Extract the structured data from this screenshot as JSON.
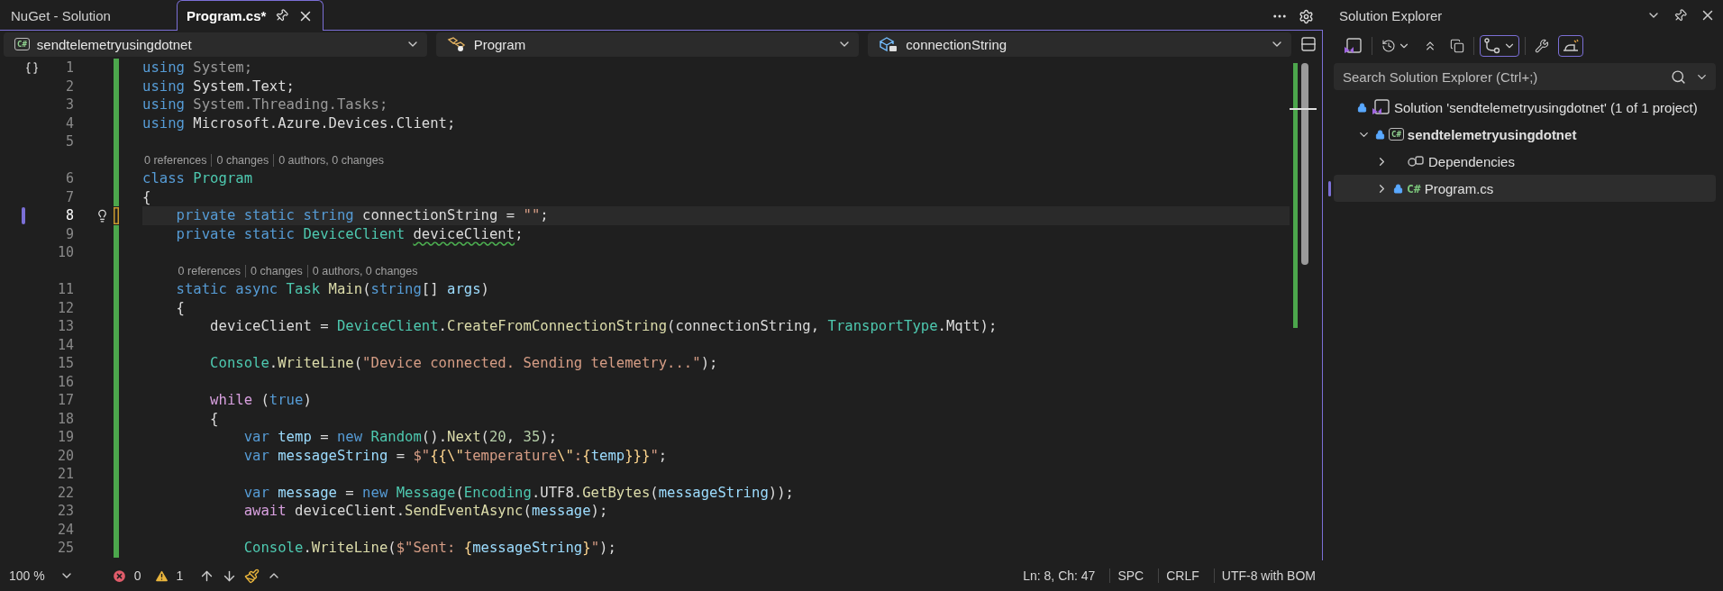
{
  "tabs": [
    {
      "label": "NuGet - Solution",
      "selected": false,
      "pinned": false
    },
    {
      "label": "Program.cs*",
      "selected": true,
      "pinned": true
    }
  ],
  "nav_bar": {
    "project": {
      "icon_text": "C#",
      "label": "sendtelemetryusingdotnet"
    },
    "type": {
      "label": "Program"
    },
    "member": {
      "label": "connectionString"
    }
  },
  "editor": {
    "lines": [
      {
        "number": "1",
        "current": false,
        "unsaved": false,
        "tokens": [
          {
            "kind": "kw",
            "text": "using"
          },
          {
            "kind": "dim",
            "text": " System;"
          }
        ]
      },
      {
        "number": "2",
        "current": false,
        "unsaved": false,
        "tokens": [
          {
            "kind": "kw",
            "text": "using"
          },
          {
            "kind": "plain",
            "text": " System.Text;"
          }
        ]
      },
      {
        "number": "3",
        "current": false,
        "unsaved": false,
        "tokens": [
          {
            "kind": "kw",
            "text": "using"
          },
          {
            "kind": "dim",
            "text": " System.Threading.Tasks;"
          }
        ]
      },
      {
        "number": "4",
        "current": false,
        "unsaved": false,
        "tokens": [
          {
            "kind": "kw",
            "text": "using"
          },
          {
            "kind": "plain",
            "text": " Microsoft.Azure.Devices.Client;"
          }
        ]
      },
      {
        "number": "5",
        "current": false,
        "unsaved": false
      },
      {
        "number": "6",
        "current": false,
        "unsaved": false,
        "lens": [
          "0 references",
          "0 changes",
          "0 authors, 0 changes"
        ],
        "tokens": [
          {
            "kind": "kw",
            "text": "class "
          },
          {
            "kind": "type",
            "text": "Program"
          }
        ]
      },
      {
        "number": "7",
        "current": false,
        "unsaved": false,
        "tokens": [
          {
            "kind": "plain",
            "text": "{"
          }
        ]
      },
      {
        "number": "8",
        "current": true,
        "unsaved": true,
        "tokens": [
          {
            "kind": "kw",
            "text": "    private static string "
          },
          {
            "kind": "plain",
            "text": "connectionString = "
          },
          {
            "kind": "str",
            "text": "\"\""
          },
          {
            "kind": "plain",
            "text": ";"
          }
        ]
      },
      {
        "number": "9",
        "current": false,
        "unsaved": false,
        "tokens": [
          {
            "kind": "kw",
            "text": "    private static "
          },
          {
            "kind": "type",
            "text": "DeviceClient "
          },
          {
            "kind": "warn",
            "text": "deviceClient"
          },
          {
            "kind": "plain",
            "text": ";"
          }
        ]
      },
      {
        "number": "10",
        "current": false,
        "unsaved": false
      },
      {
        "number": "11",
        "current": false,
        "unsaved": false,
        "lens": [
          "0 references",
          "0 changes",
          "0 authors, 0 changes"
        ],
        "tokens": [
          {
            "kind": "kw",
            "text": "    static async "
          },
          {
            "kind": "type",
            "text": "Task "
          },
          {
            "kind": "method",
            "text": "Main"
          },
          {
            "kind": "plain",
            "text": "("
          },
          {
            "kind": "kw",
            "text": "string"
          },
          {
            "kind": "plain",
            "text": "[] "
          },
          {
            "kind": "ident",
            "text": "args"
          },
          {
            "kind": "plain",
            "text": ")"
          }
        ]
      },
      {
        "number": "12",
        "current": false,
        "unsaved": false,
        "tokens": [
          {
            "kind": "plain",
            "text": "    {"
          }
        ]
      },
      {
        "number": "13",
        "current": false,
        "unsaved": false,
        "tokens": [
          {
            "kind": "plain",
            "text": "        deviceClient = "
          },
          {
            "kind": "type",
            "text": "DeviceClient"
          },
          {
            "kind": "plain",
            "text": "."
          },
          {
            "kind": "method",
            "text": "CreateFromConnectionString"
          },
          {
            "kind": "plain",
            "text": "(connectionString, "
          },
          {
            "kind": "type",
            "text": "TransportType"
          },
          {
            "kind": "plain",
            "text": ".Mqtt);"
          }
        ]
      },
      {
        "number": "14",
        "current": false,
        "unsaved": false
      },
      {
        "number": "15",
        "current": false,
        "unsaved": false,
        "tokens": [
          {
            "kind": "type",
            "text": "        Console"
          },
          {
            "kind": "plain",
            "text": "."
          },
          {
            "kind": "method",
            "text": "WriteLine"
          },
          {
            "kind": "plain",
            "text": "("
          },
          {
            "kind": "str",
            "text": "\"Device connected. Sending telemetry...\""
          },
          {
            "kind": "plain",
            "text": ");"
          }
        ]
      },
      {
        "number": "16",
        "current": false,
        "unsaved": false
      },
      {
        "number": "17",
        "current": false,
        "unsaved": false,
        "tokens": [
          {
            "kind": "ctrl",
            "text": "        while "
          },
          {
            "kind": "plain",
            "text": "("
          },
          {
            "kind": "kw",
            "text": "true"
          },
          {
            "kind": "plain",
            "text": ")"
          }
        ]
      },
      {
        "number": "18",
        "current": false,
        "unsaved": false,
        "tokens": [
          {
            "kind": "plain",
            "text": "        {"
          }
        ]
      },
      {
        "number": "19",
        "current": false,
        "unsaved": false,
        "tokens": [
          {
            "kind": "kw",
            "text": "            var "
          },
          {
            "kind": "ident",
            "text": "temp"
          },
          {
            "kind": "plain",
            "text": " = "
          },
          {
            "kind": "kw",
            "text": "new "
          },
          {
            "kind": "type",
            "text": "Random"
          },
          {
            "kind": "plain",
            "text": "()."
          },
          {
            "kind": "method",
            "text": "Next"
          },
          {
            "kind": "plain",
            "text": "("
          },
          {
            "kind": "num",
            "text": "20"
          },
          {
            "kind": "plain",
            "text": ", "
          },
          {
            "kind": "num",
            "text": "35"
          },
          {
            "kind": "plain",
            "text": ");"
          }
        ]
      },
      {
        "number": "20",
        "current": false,
        "unsaved": false,
        "tokens": [
          {
            "kind": "kw",
            "text": "            var "
          },
          {
            "kind": "ident",
            "text": "messageString"
          },
          {
            "kind": "plain",
            "text": " = "
          },
          {
            "kind": "str",
            "text": "$\""
          },
          {
            "kind": "esc",
            "text": "{{\\\""
          },
          {
            "kind": "str",
            "text": "temperature"
          },
          {
            "kind": "esc",
            "text": "\\\""
          },
          {
            "kind": "str",
            "text": ":"
          },
          {
            "kind": "esc",
            "text": "{"
          },
          {
            "kind": "ident",
            "text": "temp"
          },
          {
            "kind": "esc",
            "text": "}}}"
          },
          {
            "kind": "str",
            "text": "\""
          },
          {
            "kind": "plain",
            "text": ";"
          }
        ]
      },
      {
        "number": "21",
        "current": false,
        "unsaved": false
      },
      {
        "number": "22",
        "current": false,
        "unsaved": false,
        "tokens": [
          {
            "kind": "kw",
            "text": "            var "
          },
          {
            "kind": "ident",
            "text": "message"
          },
          {
            "kind": "plain",
            "text": " = "
          },
          {
            "kind": "kw",
            "text": "new "
          },
          {
            "kind": "type",
            "text": "Message"
          },
          {
            "kind": "plain",
            "text": "("
          },
          {
            "kind": "type",
            "text": "Encoding"
          },
          {
            "kind": "plain",
            "text": ".UTF8."
          },
          {
            "kind": "method",
            "text": "GetBytes"
          },
          {
            "kind": "plain",
            "text": "("
          },
          {
            "kind": "ident",
            "text": "messageString"
          },
          {
            "kind": "plain",
            "text": "));"
          }
        ]
      },
      {
        "number": "23",
        "current": false,
        "unsaved": false,
        "tokens": [
          {
            "kind": "ctrl",
            "text": "            await"
          },
          {
            "kind": "plain",
            "text": " deviceClient."
          },
          {
            "kind": "method",
            "text": "SendEventAsync"
          },
          {
            "kind": "plain",
            "text": "("
          },
          {
            "kind": "ident",
            "text": "message"
          },
          {
            "kind": "plain",
            "text": ");"
          }
        ]
      },
      {
        "number": "24",
        "current": false,
        "unsaved": false
      },
      {
        "number": "25",
        "current": false,
        "unsaved": false,
        "tokens": [
          {
            "kind": "type",
            "text": "            Console"
          },
          {
            "kind": "plain",
            "text": "."
          },
          {
            "kind": "method",
            "text": "WriteLine"
          },
          {
            "kind": "plain",
            "text": "("
          },
          {
            "kind": "str",
            "text": "$\"Sent: "
          },
          {
            "kind": "esc",
            "text": "{"
          },
          {
            "kind": "ident",
            "text": "messageString"
          },
          {
            "kind": "esc",
            "text": "}"
          },
          {
            "kind": "str",
            "text": "\""
          },
          {
            "kind": "plain",
            "text": ");"
          }
        ]
      }
    ]
  },
  "status_bar": {
    "zoom": "100 %",
    "errors": "0",
    "warnings": "1",
    "position": "Ln: 8, Ch: 47",
    "indentation": "SPC",
    "line_ending": "CRLF",
    "encoding": "UTF-8 with BOM"
  },
  "solution_explorer": {
    "title": "Solution Explorer",
    "toolbar": [
      {
        "kind": "switch_views",
        "selected": false,
        "dropdown": false,
        "separator_before": false
      },
      {
        "kind": "pending_changes",
        "selected": false,
        "dropdown": true,
        "separator_before": true
      },
      {
        "kind": "collapse_all",
        "selected": false,
        "dropdown": false,
        "separator_before": false
      },
      {
        "kind": "show_all_files",
        "selected": false,
        "dropdown": false,
        "separator_before": false
      },
      {
        "kind": "git_graph",
        "selected": true,
        "dropdown": true,
        "separator_before": true
      },
      {
        "kind": "properties",
        "selected": false,
        "dropdown": false,
        "separator_before": true
      },
      {
        "kind": "preview",
        "selected": true,
        "dropdown": false,
        "separator_before": false
      }
    ],
    "search": {
      "placeholder": "Search Solution Explorer (Ctrl+;)"
    },
    "tree": [
      {
        "kind": "solution",
        "label": "Solution 'sendtelemetryusingdotnet' (1 of 1 project)",
        "locked": true,
        "selected": false,
        "children": [
          {
            "kind": "project",
            "icon_text": "C#",
            "label": "sendtelemetryusingdotnet",
            "startup": true,
            "locked": true,
            "expanded": true,
            "selected": false,
            "children": [
              {
                "kind": "dependencies",
                "label": "Dependencies",
                "locked": false,
                "expanded": false,
                "selected": false
              },
              {
                "kind": "file",
                "icon_text": "C#",
                "label": "Program.cs",
                "locked": true,
                "expanded": false,
                "selected": true
              }
            ]
          }
        ]
      }
    ]
  }
}
